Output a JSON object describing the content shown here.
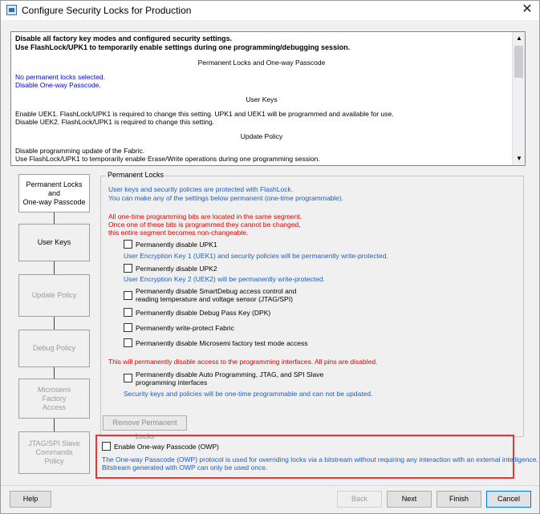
{
  "window": {
    "title": "Configure Security Locks for Production",
    "close_glyph": "✕"
  },
  "summary": {
    "line1": "Disable all factory key modes and configured security settings.",
    "line2": "Use FlashLock/UPK1 to temporarily enable settings during one programming/debugging session.",
    "heading1": "Permanent Locks and One-way Passcode",
    "pl1": "No permanent locks selected.",
    "pl2": "Disable One-way Passcode.",
    "heading2": "User Keys",
    "uk1": "Enable UEK1. FlashLock/UPK1 is required to change this setting. UPK1 and UEK1 will be programmed and available for use.",
    "uk2": "Disable UEK2. FlashLock/UPK1 is required to change this setting.",
    "heading3": "Update Policy",
    "up1": "Disable programming update of the Fabric.",
    "up2": "Use FlashLock/UPK1 to temporarily enable Erase/Write operations during one programming session."
  },
  "nav": {
    "permanent_locks": "Permanent Locks\nand\nOne-way Passcode",
    "user_keys": "User Keys",
    "update_policy": "Update Policy",
    "debug_policy": "Debug Policy",
    "microsemi_factory": "Microsemi\nFactory\nAccess",
    "jtag_spi": "JTAG/SPI Slave\nCommands\nPolicy"
  },
  "panel": {
    "legend": "Permanent Locks",
    "info1": "User keys and security policies are protected with FlashLock.",
    "info2": "You can make any of the settings below permanent (one-time programmable).",
    "warn1": "All one-time programming bits are located in the same segment.",
    "warn2": "Once one of these bits is programmed they cannot be changed,",
    "warn3": "this entire segment becomes non-changeable.",
    "cb_upk1": "Permanently disable UPK1",
    "cb_upk1_note": "User Encryption Key 1 (UEK1) and security policies will be permanently write-protected.",
    "cb_upk2": "Permanently disable UPK2",
    "cb_upk2_note": "User Encryption Key 2 (UEK2) will be permanently write-protected.",
    "cb_smartdebug_1": "Permanently disable SmartDebug access control and",
    "cb_smartdebug_2": "reading temperature and voltage sensor (JTAG/SPI)",
    "cb_dpk": "Permanently disable Debug Pass Key (DPK)",
    "cb_fabric": "Permanently write-protect Fabric",
    "cb_factory": "Permanently disable Microsemi factory test mode access",
    "warn_interfaces": "This will permanently disable access to the programming interfaces. All pins are disabled.",
    "cb_auto_1": "Permanently disable Auto Programming, JTAG, and SPI Slave",
    "cb_auto_2": "programming interfaces",
    "auto_note": "Security keys and policies will be one-time programmable and can not be updated.",
    "remove_button": "Remove Permanent Locks"
  },
  "owp": {
    "checkbox_label": "Enable One-way Passcode (OWP)",
    "note1": "The One-way Passcode (OWP) protocol is used for overriding locks via a bitstream without requiring any interaction with an external intelligence.",
    "note2": "Bitstream generated with OWP can only be used once."
  },
  "buttons": {
    "help": "Help",
    "back": "Back",
    "next": "Next",
    "finish": "Finish",
    "cancel": "Cancel"
  }
}
